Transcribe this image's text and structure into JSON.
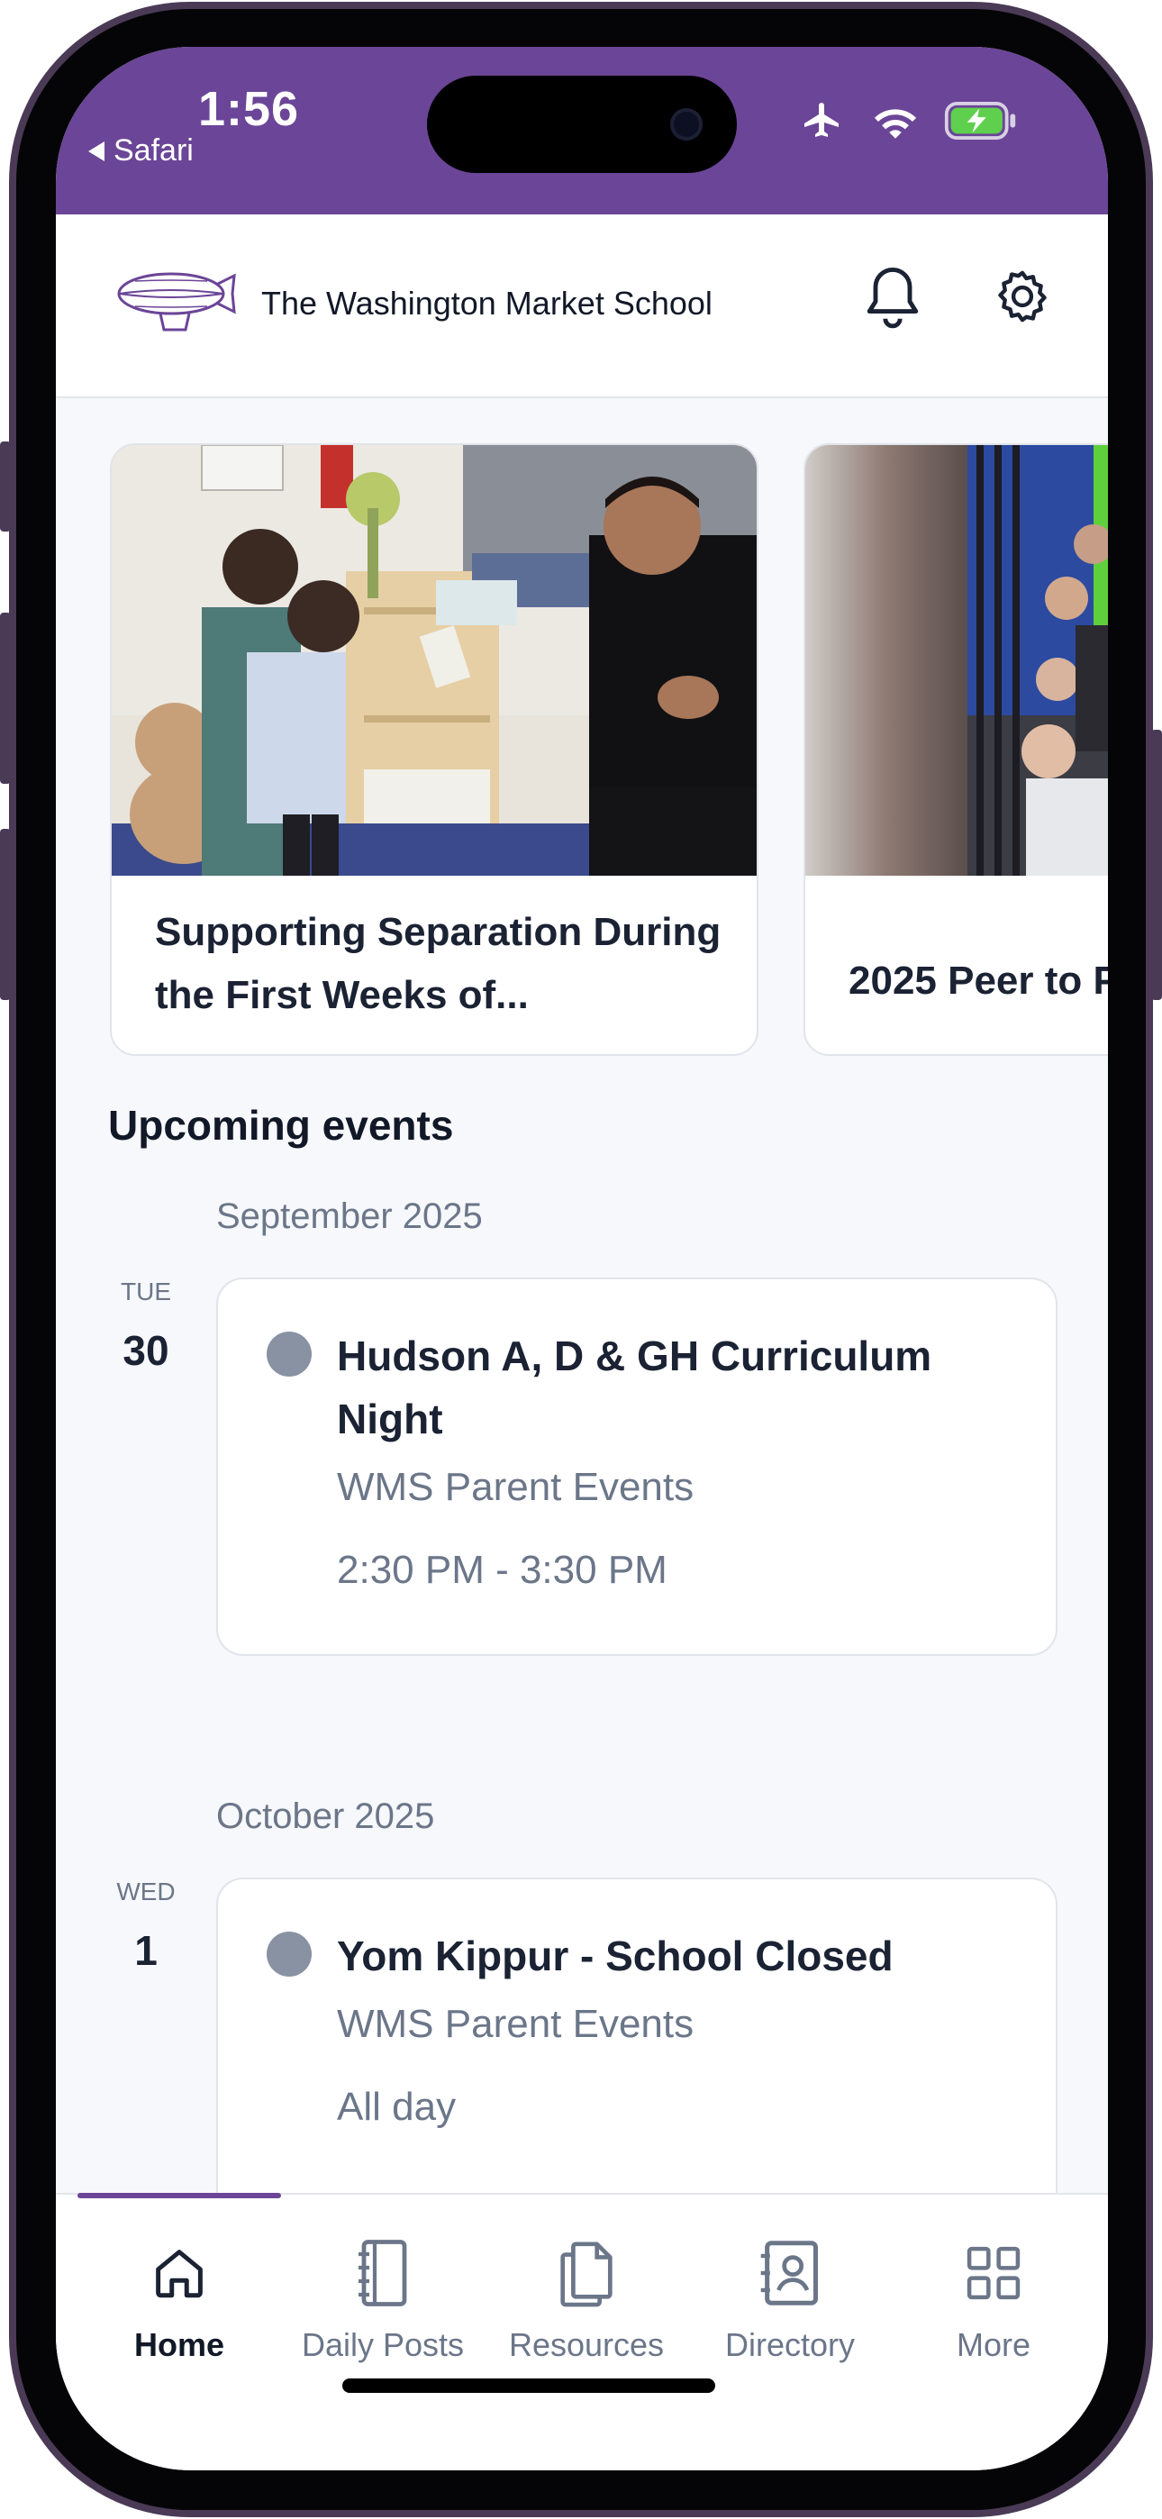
{
  "status_bar": {
    "time": "1:56",
    "back_app": "Safari",
    "icons": [
      "airplane-icon",
      "wifi-icon",
      "battery-charging-icon"
    ],
    "background_color": "#6b4597"
  },
  "header": {
    "school_name": "The Washington Market School",
    "logo_icon": "blimp-icon",
    "actions": [
      "bell-icon",
      "gear-icon"
    ]
  },
  "carousel": [
    {
      "title": "Supporting Separation During the First Weeks of..."
    },
    {
      "title": "2025 Peer to P"
    }
  ],
  "upcoming": {
    "section_title": "Upcoming events",
    "groups": [
      {
        "month": "September 2025",
        "day_of_week": "TUE",
        "day": "30",
        "event": {
          "title": "Hudson A, D & GH Curriculum Night",
          "calendar": "WMS Parent Events",
          "time": "2:30 PM - 3:30 PM"
        }
      },
      {
        "month": "October 2025",
        "day_of_week": "WED",
        "day": "1",
        "event": {
          "title": "Yom Kippur - School Closed",
          "calendar": "WMS Parent Events",
          "time": "All day"
        }
      }
    ]
  },
  "tabs": [
    {
      "label": "Home",
      "icon": "home-icon",
      "active": true
    },
    {
      "label": "Daily Posts",
      "icon": "notebook-icon",
      "active": false
    },
    {
      "label": "Resources",
      "icon": "documents-icon",
      "active": false
    },
    {
      "label": "Directory",
      "icon": "contact-card-icon",
      "active": false
    },
    {
      "label": "More",
      "icon": "grid-icon",
      "active": false
    }
  ],
  "colors": {
    "accent": "#6b4597",
    "text_primary": "#1a2233",
    "text_secondary": "#6b7689",
    "event_dot": "#8892a3"
  }
}
